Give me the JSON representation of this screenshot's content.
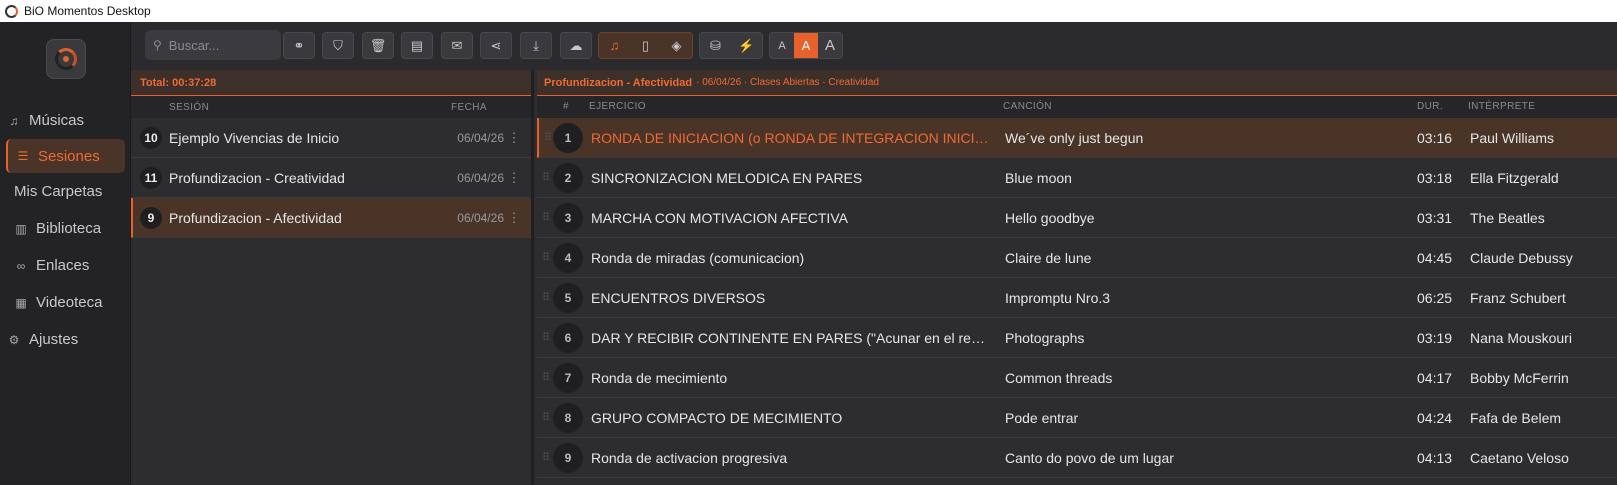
{
  "window": {
    "title": "BiO Momentos Desktop"
  },
  "sidebar": {
    "items": [
      {
        "label": "Músicas",
        "icon": "music-note-icon"
      },
      {
        "label": "Sesiones",
        "icon": "playlist-icon",
        "active": true
      },
      {
        "label": "Mis Carpetas",
        "icon": ""
      },
      {
        "label": "Biblioteca",
        "icon": "library-icon"
      },
      {
        "label": "Enlaces",
        "icon": "link-icon"
      },
      {
        "label": "Videoteca",
        "icon": "film-icon"
      },
      {
        "label": "Ajustes",
        "icon": "gear-icon"
      }
    ]
  },
  "toolbar": {
    "search_placeholder": "Buscar...",
    "font_sizes": [
      "A",
      "A",
      "A"
    ],
    "accent_color": "#e8612c"
  },
  "sessions": {
    "total": "Total: 00:37:28",
    "header_session": "SESIÓN",
    "header_date": "FECHA",
    "rows": [
      {
        "num": "10",
        "name": "Ejemplo Vivencias de Inicio",
        "date": "06/04/26"
      },
      {
        "num": "11",
        "name": "Profundizacion - Creatividad",
        "date": "06/04/26"
      },
      {
        "num": "9",
        "name": "Profundizacion - Afectividad",
        "date": "06/04/26",
        "active": true
      }
    ]
  },
  "exercises": {
    "title": "Profundizacion - Afectividad",
    "meta": "· 06/04/26 · Clases Abiertas · Creatividad",
    "headers": {
      "num": "#",
      "exercise": "EJERCICIO",
      "song": "CANCIÓN",
      "duration": "DUR.",
      "artist": "INTÉRPRETE"
    },
    "rows": [
      {
        "num": "1",
        "exercise": "RONDA DE INICIACION (o RONDA DE INTEGRACION INICIAL)",
        "song": "We´ve only just begun",
        "duration": "03:16",
        "artist": "Paul Williams",
        "active": true
      },
      {
        "num": "2",
        "exercise": "SINCRONIZACION MELODICA EN PARES",
        "song": "Blue moon",
        "duration": "03:18",
        "artist": "Ella Fitzgerald"
      },
      {
        "num": "3",
        "exercise": "MARCHA CON MOTIVACION AFECTIVA",
        "song": "Hello goodbye",
        "duration": "03:31",
        "artist": "The Beatles"
      },
      {
        "num": "4",
        "exercise": "Ronda de miradas (comunicacion)",
        "song": "Claire de lune",
        "duration": "04:45",
        "artist": "Claude Debussy"
      },
      {
        "num": "5",
        "exercise": "ENCUENTROS DIVERSOS",
        "song": "Impromptu Nro.3",
        "duration": "06:25",
        "artist": "Franz Schubert"
      },
      {
        "num": "6",
        "exercise": "DAR Y RECIBIR CONTINENTE EN PARES (\"Acunar en el regaz...",
        "song": "Photographs",
        "duration": "03:19",
        "artist": "Nana Mouskouri"
      },
      {
        "num": "7",
        "exercise": "Ronda de mecimiento",
        "song": "Common threads",
        "duration": "04:17",
        "artist": "Bobby McFerrin"
      },
      {
        "num": "8",
        "exercise": "GRUPO COMPACTO DE MECIMIENTO",
        "song": "Pode entrar",
        "duration": "04:24",
        "artist": "Fafa de Belem"
      },
      {
        "num": "9",
        "exercise": "Ronda de activacion progresiva",
        "song": "Canto do povo de um lugar",
        "duration": "04:13",
        "artist": "Caetano Veloso"
      }
    ]
  }
}
